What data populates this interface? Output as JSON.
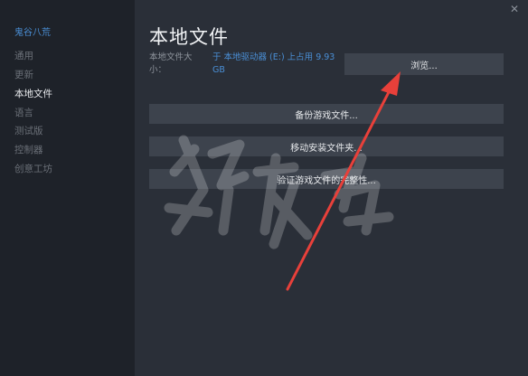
{
  "sidebar": {
    "game_title": "鬼谷八荒",
    "items": [
      {
        "label": "通用",
        "active": false
      },
      {
        "label": "更新",
        "active": false
      },
      {
        "label": "本地文件",
        "active": true
      },
      {
        "label": "语言",
        "active": false
      },
      {
        "label": "测试版",
        "active": false
      },
      {
        "label": "控制器",
        "active": false
      },
      {
        "label": "创意工坊",
        "active": false
      }
    ]
  },
  "main": {
    "title": "本地文件",
    "size_label": "本地文件大小：",
    "size_value": "于 本地驱动器 (E:) 上占用 9.93 GB",
    "browse_button": "浏览...",
    "backup_button": "备份游戏文件...",
    "move_button": "移动安装文件夹...",
    "verify_button": "验证游戏文件的完整性..."
  },
  "window": {
    "close_glyph": "✕"
  },
  "overlay": {
    "arrow_color": "#e8403a",
    "watermark": "游侠网"
  },
  "colors": {
    "accent": "#4a8fd6",
    "sidebar_bg": "#1e2229",
    "main_bg": "#2a2f38",
    "button_bg": "#3d434d"
  }
}
